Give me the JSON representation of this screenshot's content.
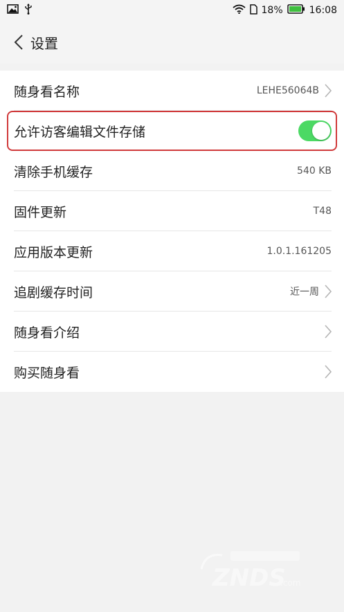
{
  "status_bar": {
    "battery_percent": "18%",
    "time": "16:08",
    "icons": [
      "image-icon",
      "usb-icon",
      "wifi-icon",
      "sim-icon",
      "battery-icon"
    ]
  },
  "header": {
    "title": "设置",
    "back_icon": "chevron-left-icon"
  },
  "settings": {
    "items": [
      {
        "label": "随身看名称",
        "value": "LEHE56064B"
      },
      {
        "label": "允许访客编辑文件存储",
        "toggle_on": true
      },
      {
        "label": "清除手机缓存",
        "value": "540 KB"
      },
      {
        "label": "固件更新",
        "value": "T48"
      },
      {
        "label": "应用版本更新",
        "value": "1.0.1.161205"
      },
      {
        "label": "追剧缓存时间",
        "value": "近一周"
      },
      {
        "label": "随身看介绍",
        "value": ""
      },
      {
        "label": "购买随身看",
        "value": ""
      }
    ]
  },
  "colors": {
    "toggle_on": "#4cd964",
    "highlight_border": "#d0393a",
    "background": "#f2f2f2"
  },
  "watermark": {
    "text": "ZNDS.com"
  }
}
